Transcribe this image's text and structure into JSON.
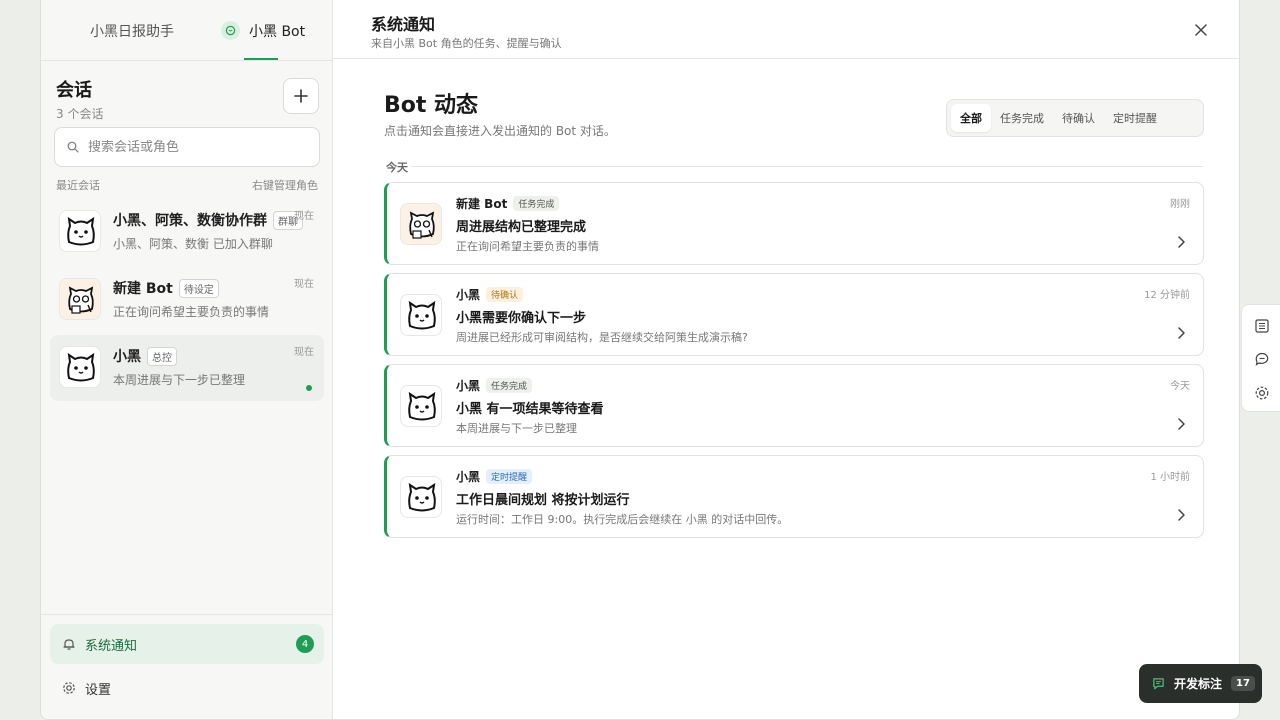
{
  "sidebar": {
    "tabs": [
      {
        "label": "小黑日报助手"
      },
      {
        "label": "小黑 Bot"
      }
    ],
    "conversations_title": "会话",
    "conversations_count": "3 个会话",
    "search_placeholder": "搜索会话或角色",
    "recent_label": "最近会话",
    "manage_hint": "右键管理角色",
    "items": [
      {
        "name": "小黑、阿策、数衡协作群",
        "tag": "群聊",
        "preview": "小黑、阿策、数衡 已加入群聊",
        "time": "现在"
      },
      {
        "name": "新建 Bot",
        "tag": "待设定",
        "preview": "正在询问希望主要负责的事情",
        "time": "现在"
      },
      {
        "name": "小黑",
        "tag": "总控",
        "preview": "本周进展与下一步已整理",
        "time": "现在"
      }
    ],
    "notifications_label": "系统通知",
    "notifications_count": "4",
    "settings_label": "设置"
  },
  "main": {
    "header_title": "系统通知",
    "header_subtitle": "来自小黑 Bot 角色的任务、提醒与确认",
    "section_title": "Bot 动态",
    "section_subtitle": "点击通知会直接进入发出通知的 Bot 对话。",
    "filters": [
      {
        "label": "全部"
      },
      {
        "label": "任务完成"
      },
      {
        "label": "待确认"
      },
      {
        "label": "定时提醒"
      }
    ],
    "active_filter": "全部",
    "day_label": "今天",
    "notifications": [
      {
        "sender": "新建 Bot",
        "tag": "任务完成",
        "title": "周进展结构已整理完成",
        "body": "正在询问希望主要负责的事情",
        "time": "刚刚"
      },
      {
        "sender": "小黑",
        "tag": "待确认",
        "title": "小黑需要你确认下一步",
        "body": "周进展已经形成可审阅结构，是否继续交给阿策生成演示稿?",
        "time": "12 分钟前"
      },
      {
        "sender": "小黑",
        "tag": "任务完成",
        "title": "小黑 有一项结果等待查看",
        "body": "本周进展与下一步已整理",
        "time": "今天"
      },
      {
        "sender": "小黑",
        "tag": "定时提醒",
        "title": "工作日晨间规划 将按计划运行",
        "body": "运行时间：工作日 9:00。执行完成后会继续在 小黑 的对话中回传。",
        "time": "1 小时前"
      }
    ]
  },
  "dev_button": {
    "label": "开发标注",
    "count": "17"
  },
  "colors": {
    "accent": "#1e9e55",
    "background": "#eceeea",
    "dev_button": "#2b2f2c"
  }
}
